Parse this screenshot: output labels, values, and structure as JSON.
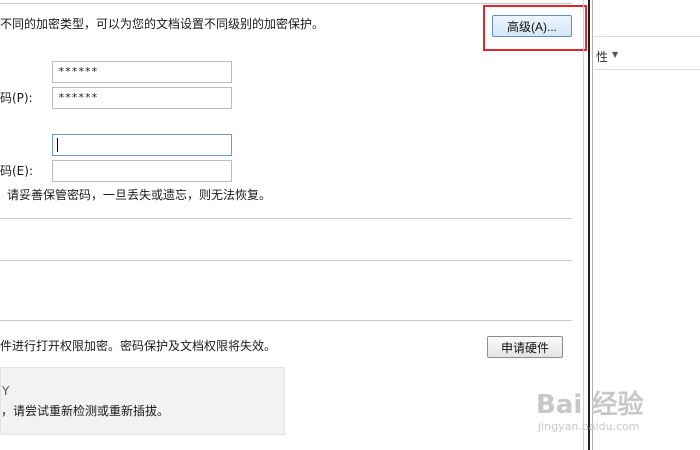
{
  "encryption": {
    "description": "不同的加密类型，可以为您的文档设置不同级别的加密保护。",
    "advanced_button": "高级(A)...",
    "open_password_value": "******",
    "open_confirm_label": "码(P):",
    "open_confirm_value": "******",
    "edit_password_value": "",
    "edit_confirm_label": "码(E):",
    "edit_confirm_value": "",
    "warning": "请妥善保管密码，一旦丢失或遗忘，则无法恢复。"
  },
  "hardware": {
    "description": "件进行打开权限加密。密码保护及文档权限将失效。",
    "apply_button": "申请硬件",
    "status_title": "Y",
    "status_message": "，请尝试重新检测或重新插拔。"
  },
  "right_panel": {
    "label": "性"
  },
  "watermark": {
    "logo": "Bai 经验",
    "url": "jingyan.baidu.com"
  },
  "colors": {
    "highlight": "#e0252b",
    "accent_border": "#5f8fc6"
  }
}
